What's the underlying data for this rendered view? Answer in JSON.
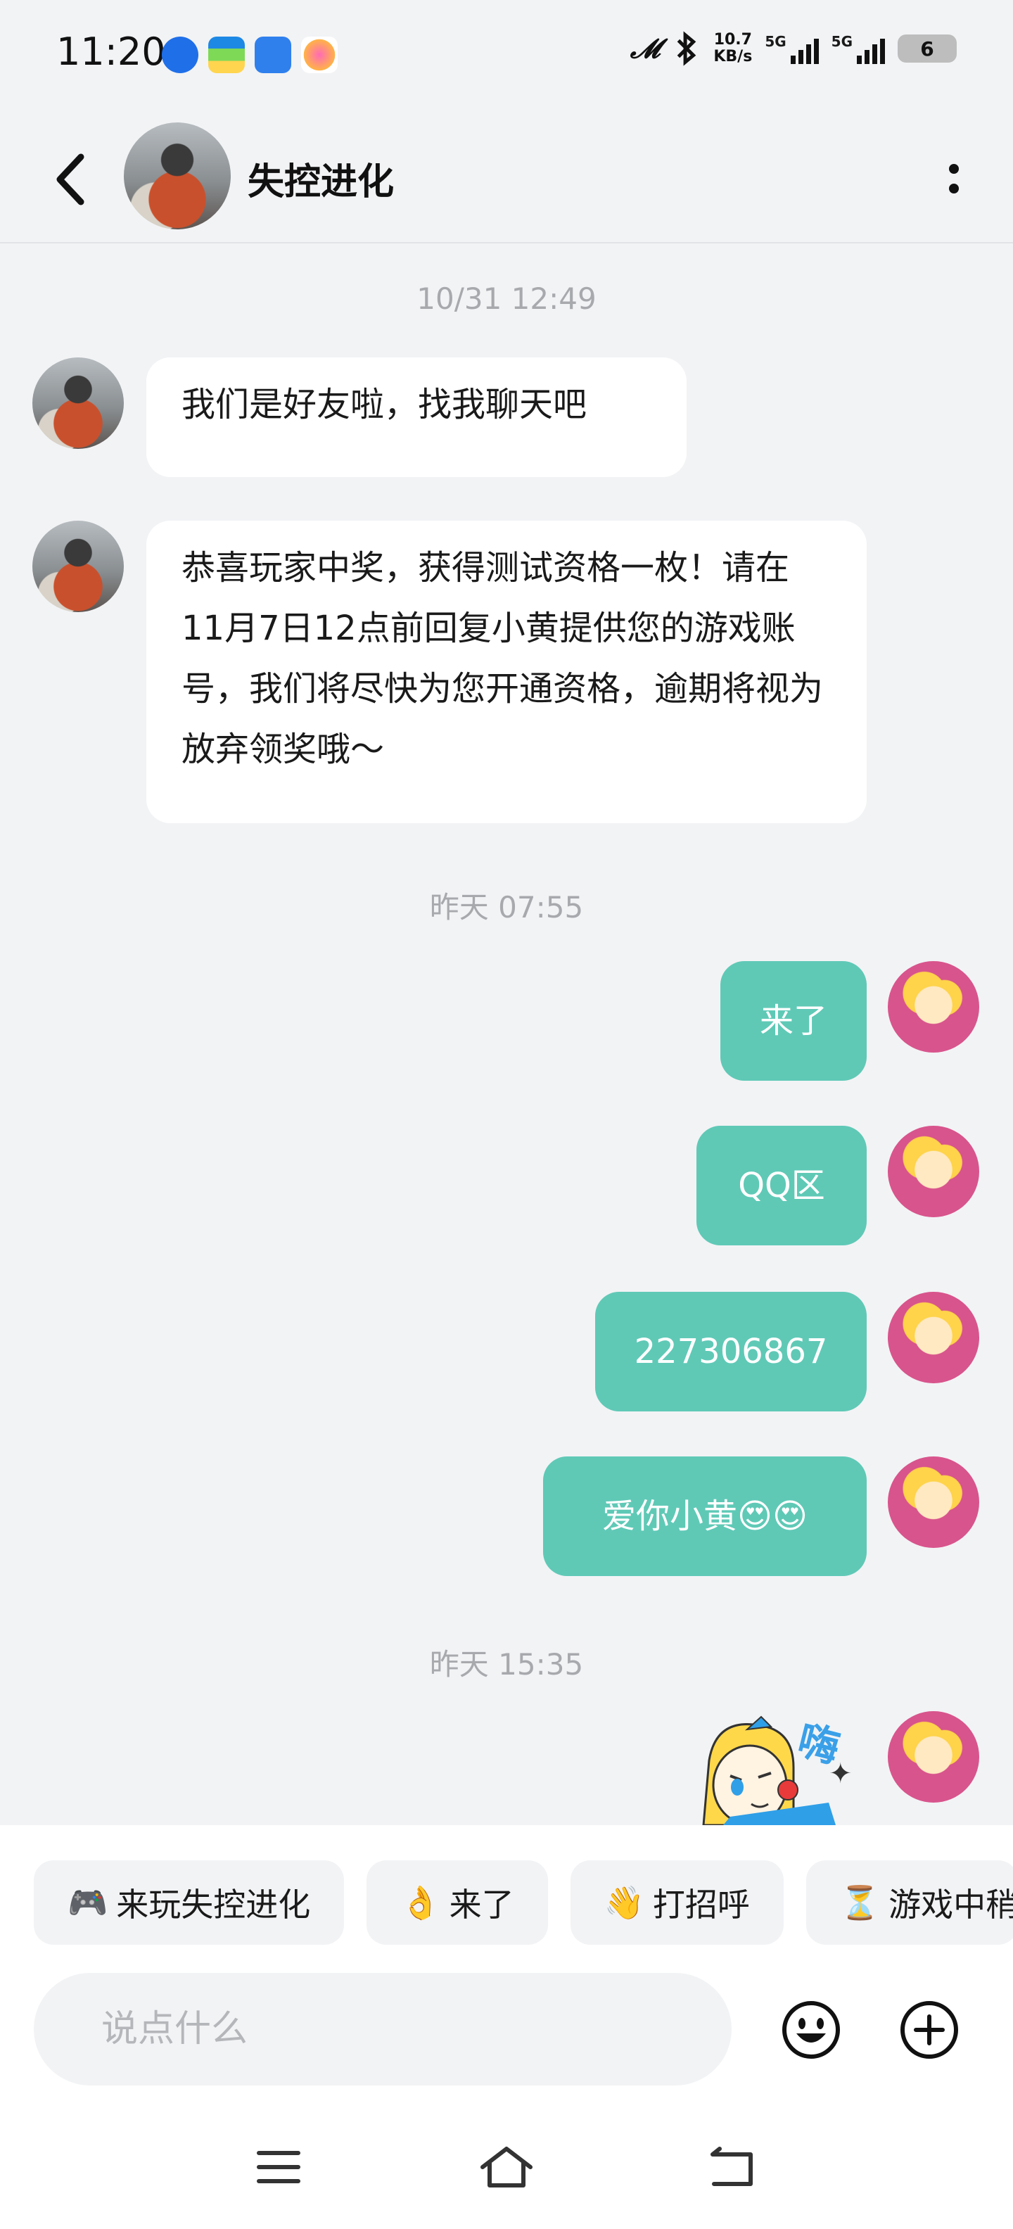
{
  "status_bar": {
    "time": "11:20",
    "net_speed_value": "10.7",
    "net_speed_unit": "KB/s",
    "signal1_label": "5G",
    "signal2_label": "5G",
    "battery": "6"
  },
  "header": {
    "title": "失控进化"
  },
  "messages": {
    "ts1": "10/31  12:49",
    "m1": "我们是好友啦，找我聊天吧",
    "m2": "恭喜玩家中奖，获得测试资格一枚！请在11月7日12点前回复小黄提供您的游戏账号，我们将尽快为您开通资格，逾期将视为放弃领奖哦～",
    "ts2": "昨天  07:55",
    "m3": "来了",
    "m4": "QQ区",
    "m5": "227306867",
    "m6": "爱你小黄😍😍",
    "ts3": "昨天  15:35",
    "sticker_text": "嗨"
  },
  "quick_replies": [
    {
      "emoji": "🎮",
      "label": "来玩失控进化"
    },
    {
      "emoji": "👌",
      "label": "来了"
    },
    {
      "emoji": "👋",
      "label": "打招呼"
    },
    {
      "emoji": "⏳",
      "label": "游戏中稍"
    }
  ],
  "input": {
    "placeholder": "说点什么"
  },
  "colors": {
    "bubble_out": "#5fc9b6",
    "bubble_in": "#ffffff",
    "background": "#f2f3f5"
  },
  "icons": {
    "back": "chevron-left-icon",
    "more": "more-vertical-icon",
    "emoji": "smiley-icon",
    "plus": "plus-circle-icon",
    "nav_menu": "menu-icon",
    "nav_home": "home-icon",
    "nav_back": "back-icon"
  }
}
